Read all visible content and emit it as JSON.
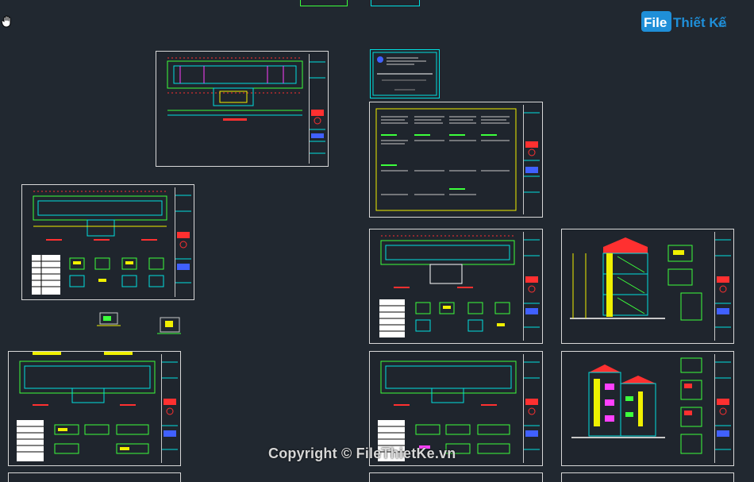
{
  "watermark": {
    "logo_left": "File",
    "logo_right": "Thiết Kế",
    "logo_suffix": ".vn",
    "copyright": "Copyright © FileThietKe.vn"
  },
  "tool": {
    "icon": "hand-pan-icon"
  },
  "colors": {
    "background": "#212830",
    "sheet_border": "#d8d8d8",
    "cad_cyan": "#00e0e0",
    "cad_green": "#3cff3c",
    "cad_red": "#ff3030",
    "cad_yellow": "#f0f000",
    "cad_blue": "#4060ff",
    "cad_magenta": "#ff40ff",
    "logo_blue": "#1f8fd8"
  }
}
